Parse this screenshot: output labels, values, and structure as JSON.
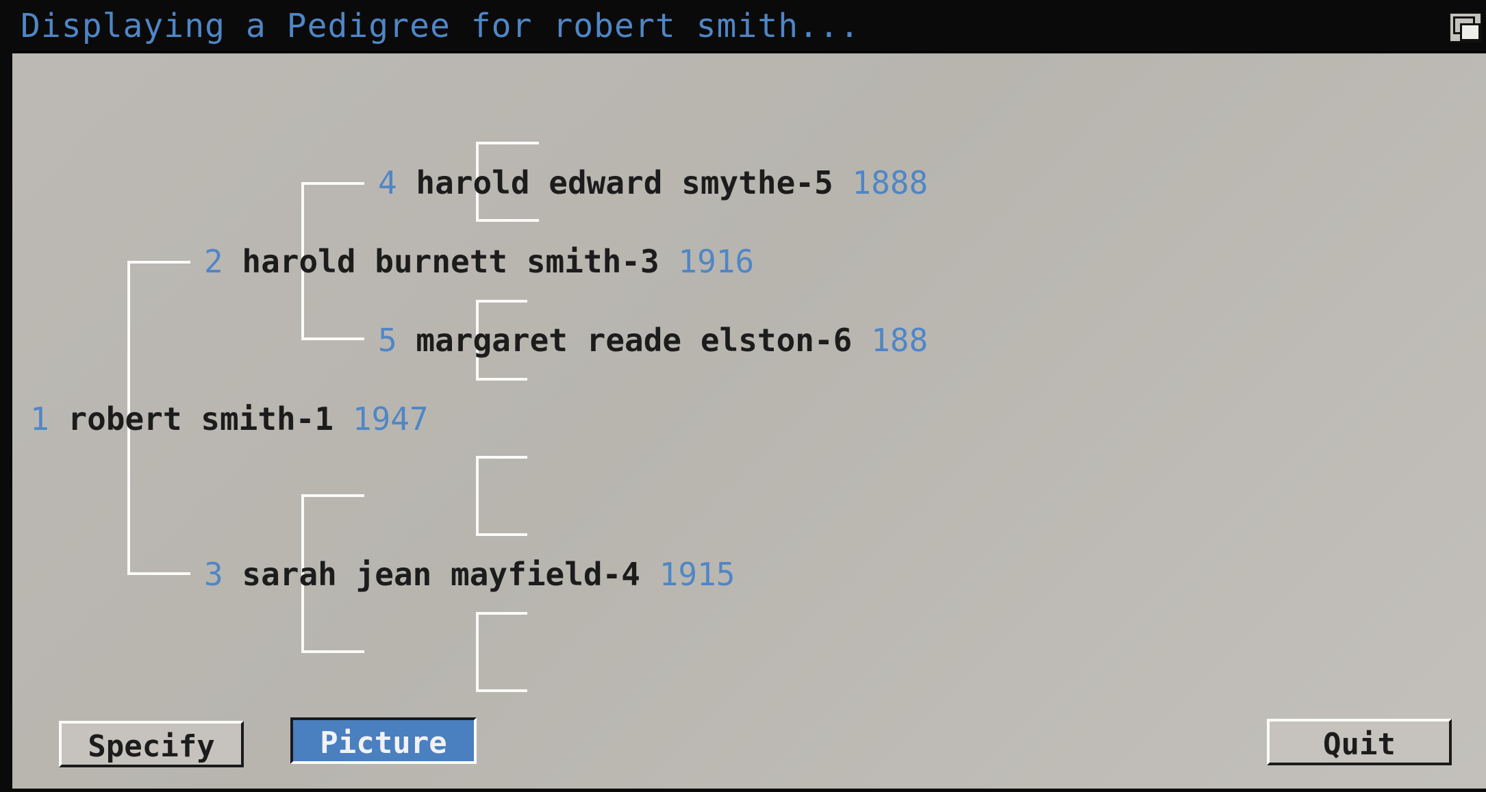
{
  "window": {
    "title": "Displaying a Pedigree for robert smith..."
  },
  "icons": {
    "depth_gadget": "window-depth-icon"
  },
  "colors": {
    "title_text": "#4f86c6",
    "number_text": "#4f86c6",
    "name_text": "#1c1c1c",
    "background": "#bcb9b4",
    "lines": "#fbfbf8",
    "active_button": "#4a7fc0"
  },
  "pedigree": [
    {
      "num": "1",
      "name": "robert smith-1",
      "year": "1947"
    },
    {
      "num": "2",
      "name": "harold burnett smith-3",
      "year": "1916"
    },
    {
      "num": "3",
      "name": "sarah jean mayfield-4",
      "year": "1915"
    },
    {
      "num": "4",
      "name": "harold edward smythe-5",
      "year": "1888"
    },
    {
      "num": "5",
      "name": "margaret reade elston-6",
      "year": "188"
    }
  ],
  "buttons": {
    "specify": "Specify",
    "picture": "Picture",
    "quit": "Quit"
  }
}
